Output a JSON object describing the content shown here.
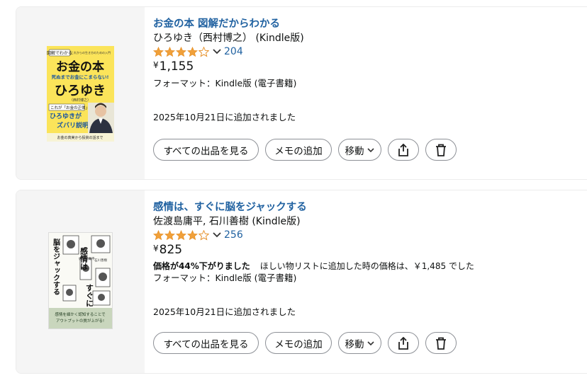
{
  "colors": {
    "link": "#2162a1",
    "star": "#f0a03a",
    "text": "#0f1111",
    "thumb_bg": "#f5f5f5"
  },
  "items": [
    {
      "title": "お金の本 図解だからわかる",
      "author": "ひろゆき（西村博之） (Kindle版)",
      "rating_stars": 4.0,
      "rating_count": "204",
      "price_symbol": "¥",
      "price": "1,155",
      "format": "フォーマット：Kindle版 (電子書籍)",
      "added": "2025年10月21日に追加されました",
      "cover": {
        "badge": "図解でわかる",
        "tagline": "これからの生き方のための入門",
        "main_title": "お金の本",
        "subtitle": "死ぬまでお金にこまらない!",
        "author_name": "ひろゆき",
        "author_real": "（西村博之）",
        "note1": "これが「お金の正体」!",
        "note2": "ひろゆきが",
        "note3": "ズバリ説明",
        "footer": "お金の真実から投資の話まで"
      },
      "buttons": {
        "all": "すべての出品を見る",
        "memo": "メモの追加",
        "move": "移動"
      },
      "icons": {
        "share": "share-icon",
        "delete": "trash-icon",
        "move_dropdown": "chevron-down-icon"
      }
    },
    {
      "title": "感情は、すぐに脳をジャックする",
      "author": "佐渡島庸平, 石川善樹 (Kindle版)",
      "rating_stars": 4.0,
      "rating_count": "256",
      "price_symbol": "¥",
      "price": "825",
      "price_drop": "価格が44%下がりました",
      "price_drop_note": "ほしい物リストに追加した時の価格は、￥1,485 でした",
      "format": "フォーマット：Kindle版 (電子書籍)",
      "added": "2025年10月21日に追加されました",
      "cover": {
        "title_col1": "感情は",
        "title_col2": "すぐに",
        "title_col3": "脳をジャックする",
        "author1": "佐渡島庸平",
        "author2": "石川善樹",
        "footer1": "感情を細かく認知することで",
        "footer2": "アウトプットの質が上がる!"
      },
      "buttons": {
        "all": "すべての出品を見る",
        "memo": "メモの追加",
        "move": "移動"
      },
      "icons": {
        "share": "share-icon",
        "delete": "trash-icon",
        "move_dropdown": "chevron-down-icon"
      }
    }
  ]
}
